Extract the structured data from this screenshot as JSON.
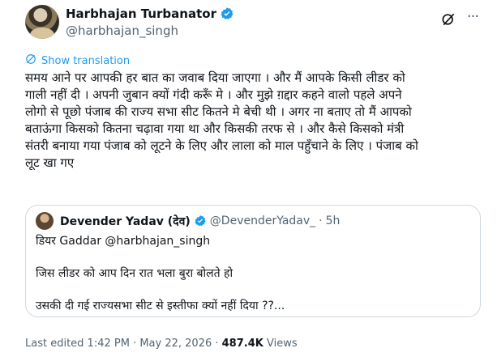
{
  "author": {
    "name": "Harbhajan Turbanator",
    "handle": "@harbhajan_singh"
  },
  "translate_label": "Show translation",
  "tweet_text": "समय आने पर आपकी हर बात का जवाब दिया जाएगा । और मैं आपके किसी लीडर को\nगाली नहीं दी । अपनी जुबान क्यों गंदी करूँ मे । और मुझे ग़द्दार कहने वालो पहले अपने\nलोगो से पूछो पंजाब की राज्य सभा सीट कितने मे बेची थी । अगर ना बताए तो मैं आपको\nबताऊंगा किसको कितना चढ़ावा गया था और किसकी तरफ से । और कैसे किसको मंत्री\nसंतरी बनाया गया पंजाब को लूटने के लिए और लाला को माल पहुँचाने के लिए । पंजाब को\nलूट खा गए",
  "quote": {
    "name": "Devender Yadav (देव)",
    "handle": "@DevenderYadav_",
    "dot": "·",
    "time": "5h",
    "body": "डियर Gaddar @harbhajan_singh\n\nजिस लीडर को आप दिन रात भला बुरा बोलते हो\n\nउसकी दी गई राज्यसभा सीट से इस्तीफा क्यों नहीं दिया ??..."
  },
  "meta": {
    "edited": "Last edited 1:42 PM · May 22, 2026 · ",
    "views_count": "487.4K",
    "views_label": " Views"
  },
  "colors": {
    "link": "#1d9bf0",
    "secondary": "#536471",
    "verified": "#1d9bf0",
    "border": "#cfd9de"
  },
  "icons": [
    "verified-badge-icon",
    "grok-icon",
    "more-icon",
    "translate-icon"
  ]
}
